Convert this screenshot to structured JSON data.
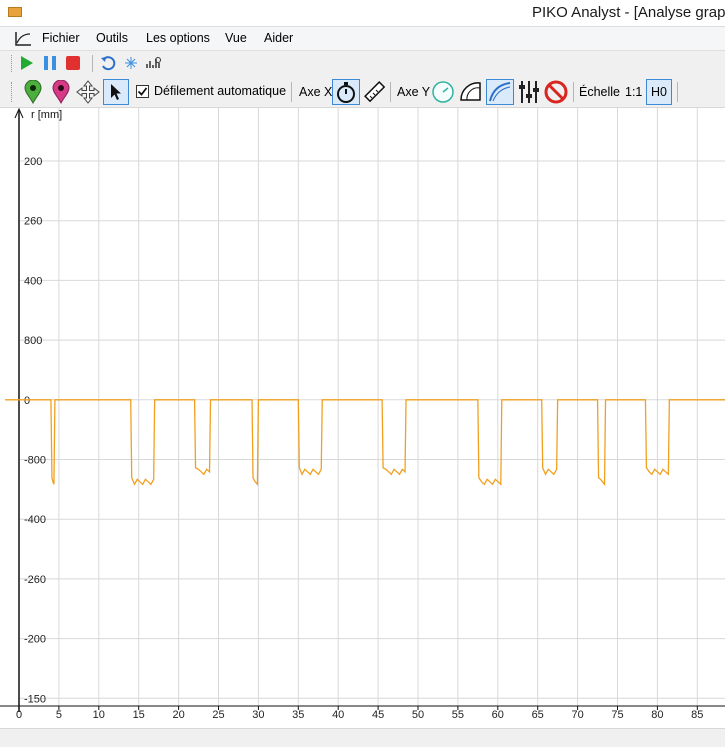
{
  "window": {
    "title": "PIKO Analyst - [Analyse graph"
  },
  "menu": {
    "items": [
      "Fichier",
      "Outils",
      "Les options",
      "Vue",
      "Aider"
    ]
  },
  "toolbar2": {
    "autoscroll_label": "Défilement automatique",
    "autoscroll_checked": true,
    "axis_x_label": "Axe X",
    "axis_y_label": "Axe Y",
    "scale_label": "Échelle",
    "scale_value": "1:1",
    "h0_label": "H0"
  },
  "colors": {
    "signal": "#f0a020",
    "grid": "#d8d8d8",
    "play": "#22aa33",
    "pause": "#3b8fe0",
    "stop": "#e03030"
  },
  "chart_data": {
    "type": "line",
    "ylabel": "r [mm]",
    "xticks": [
      "0",
      "5",
      "10",
      "15",
      "20",
      "25",
      "30",
      "35",
      "40",
      "45",
      "50",
      "55",
      "60",
      "65",
      "70",
      "75",
      "80",
      "85"
    ],
    "yticks": [
      "200",
      "260",
      "400",
      "800",
      "0",
      "-800",
      "-400",
      "-260",
      "-200",
      "-150"
    ],
    "xlim": [
      0,
      90
    ],
    "grid": true,
    "baseline_value": "0",
    "dips": [
      {
        "x_start": 4.0,
        "x_end": 4.5,
        "depth": "deep"
      },
      {
        "x_start": 14.0,
        "x_end": 17.0,
        "depth": "deep"
      },
      {
        "x_start": 22.0,
        "x_end": 24.0,
        "depth": "mid"
      },
      {
        "x_start": 29.2,
        "x_end": 30.0,
        "depth": "deep"
      },
      {
        "x_start": 35.0,
        "x_end": 38.0,
        "depth": "mid"
      },
      {
        "x_start": 45.5,
        "x_end": 48.5,
        "depth": "mid"
      },
      {
        "x_start": 57.5,
        "x_end": 60.5,
        "depth": "deep"
      },
      {
        "x_start": 65.5,
        "x_end": 67.5,
        "depth": "mid"
      },
      {
        "x_start": 72.5,
        "x_end": 73.5,
        "depth": "deep"
      },
      {
        "x_start": 78.5,
        "x_end": 81.5,
        "depth": "mid"
      }
    ]
  }
}
